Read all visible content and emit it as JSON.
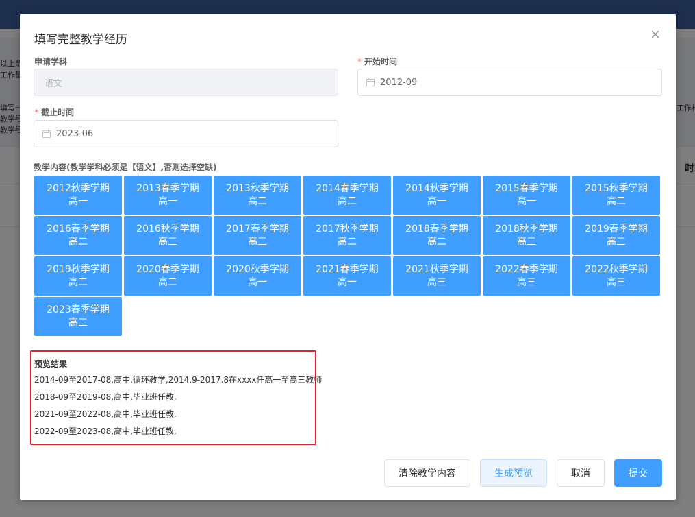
{
  "background": {
    "snippets": [
      "以上条",
      "工作量",
      "填写一",
      "教学经",
      "教学经",
      "工作相",
      "时"
    ]
  },
  "dialog": {
    "title": "填写完整教学经历",
    "subject": {
      "label": "申请学科",
      "value": "语文"
    },
    "start": {
      "label": "开始时间",
      "value": "2012-09"
    },
    "end": {
      "label": "截止时间",
      "value": "2023-06"
    },
    "content_label": "教学内容(教学学科必须是【语文】,否则选择空缺)",
    "terms": [
      {
        "term": "2012秋季学期",
        "grade": "高一"
      },
      {
        "term": "2013春季学期",
        "grade": "高一"
      },
      {
        "term": "2013秋季学期",
        "grade": "高二"
      },
      {
        "term": "2014春季学期",
        "grade": "高二"
      },
      {
        "term": "2014秋季学期",
        "grade": "高一"
      },
      {
        "term": "2015春季学期",
        "grade": "高一"
      },
      {
        "term": "2015秋季学期",
        "grade": "高二"
      },
      {
        "term": "2016春季学期",
        "grade": "高二"
      },
      {
        "term": "2016秋季学期",
        "grade": "高三"
      },
      {
        "term": "2017春季学期",
        "grade": "高三"
      },
      {
        "term": "2017秋季学期",
        "grade": "高二"
      },
      {
        "term": "2018春季学期",
        "grade": "高二"
      },
      {
        "term": "2018秋季学期",
        "grade": "高三"
      },
      {
        "term": "2019春季学期",
        "grade": "高三"
      },
      {
        "term": "2019秋季学期",
        "grade": "高二"
      },
      {
        "term": "2020春季学期",
        "grade": "高二"
      },
      {
        "term": "2020秋季学期",
        "grade": "高一"
      },
      {
        "term": "2021春季学期",
        "grade": "高一"
      },
      {
        "term": "2021秋季学期",
        "grade": "高三"
      },
      {
        "term": "2022春季学期",
        "grade": "高三"
      },
      {
        "term": "2022秋季学期",
        "grade": "高三"
      },
      {
        "term": "2023春季学期",
        "grade": "高三"
      }
    ],
    "preview": {
      "title": "预览结果",
      "lines": [
        "2014-09至2017-08,高中,循环教学,2014.9-2017.8在xxxx任高一至高三教师",
        "2018-09至2019-08,高中,毕业班任教,",
        "2021-09至2022-08,高中,毕业班任教,",
        "2022-09至2023-08,高中,毕业班任教,"
      ]
    },
    "buttons": {
      "clear": "清除教学内容",
      "generate": "生成预览",
      "cancel": "取消",
      "submit": "提交"
    }
  }
}
